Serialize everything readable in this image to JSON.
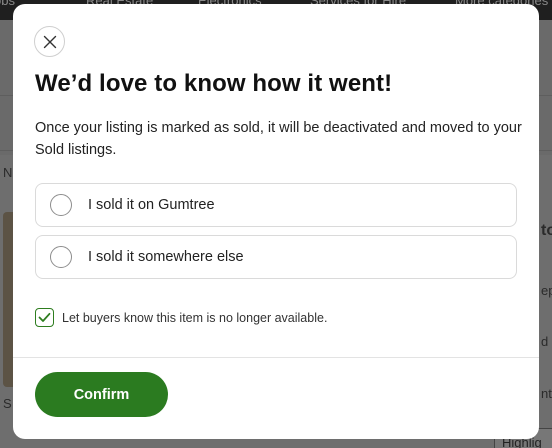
{
  "background": {
    "nav_items": [
      "obs",
      "Real Estate",
      "Electronics",
      "Services for Hire",
      "More categories"
    ],
    "left_fragment_1": "N",
    "left_fragment_2": "S",
    "right_fragment_1": "to",
    "right_fragment_2": "ep",
    "right_fragment_3": "d",
    "right_fragment_4": "nt",
    "right_button_label": "Highlig"
  },
  "modal": {
    "title": "We’d love to know how it went!",
    "description": "Once your listing is marked as sold, it will be deactivated and moved to your Sold listings.",
    "options": [
      {
        "label": "I sold it on Gumtree",
        "selected": false
      },
      {
        "label": "I sold it somewhere else",
        "selected": false
      }
    ],
    "notify_checkbox": {
      "label": "Let buyers know this item is no longer available.",
      "checked": true
    },
    "confirm_label": "Confirm",
    "close_icon": "close-icon"
  },
  "colors": {
    "accent": "#2b7b20",
    "overlay": "#6e6e6e"
  }
}
